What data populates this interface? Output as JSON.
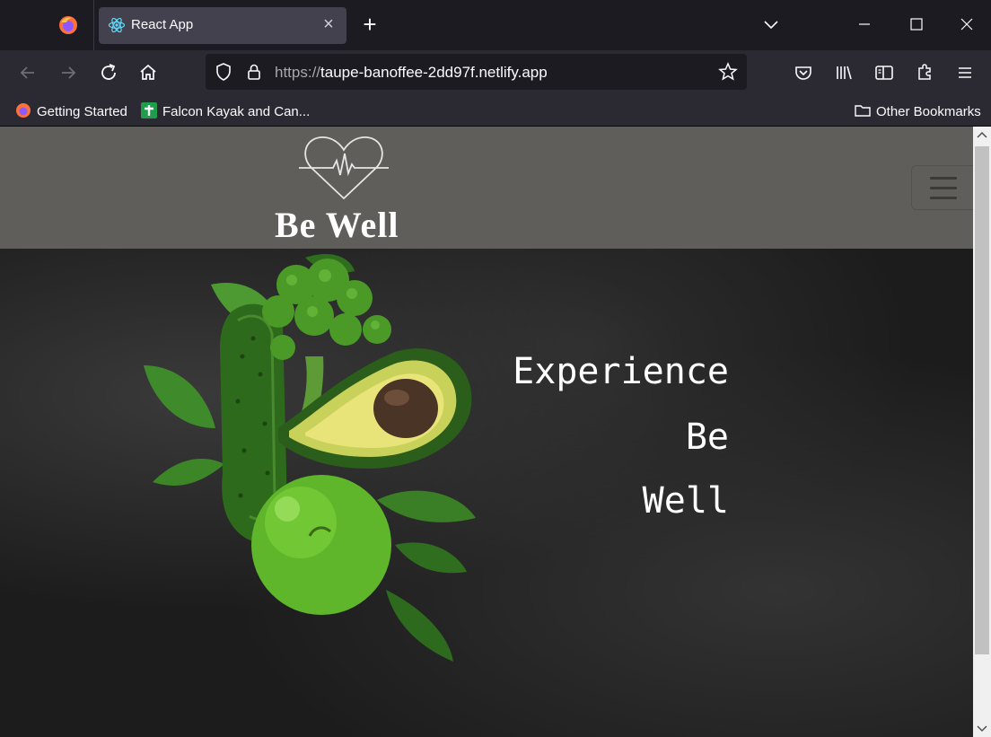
{
  "browser": {
    "tab": {
      "title": "React App"
    },
    "url": {
      "scheme": "https://",
      "host": "taupe-banoffee-2dd97f.netlify.app"
    },
    "bookmarks": [
      {
        "label": "Getting Started",
        "icon": "firefox-icon"
      },
      {
        "label": "Falcon Kayak and Can...",
        "icon": "green-cross-icon"
      }
    ],
    "other_bookmarks": "Other Bookmarks"
  },
  "site": {
    "brand": "Be Well",
    "hero": {
      "line1": "Experience",
      "line2": "Be",
      "line3": "Well"
    }
  },
  "colors": {
    "header_bg": "#5f5e5b",
    "hero_bg": "#1c1c1c",
    "tab_active": "#42414d",
    "toolbar": "#2b2a33"
  }
}
